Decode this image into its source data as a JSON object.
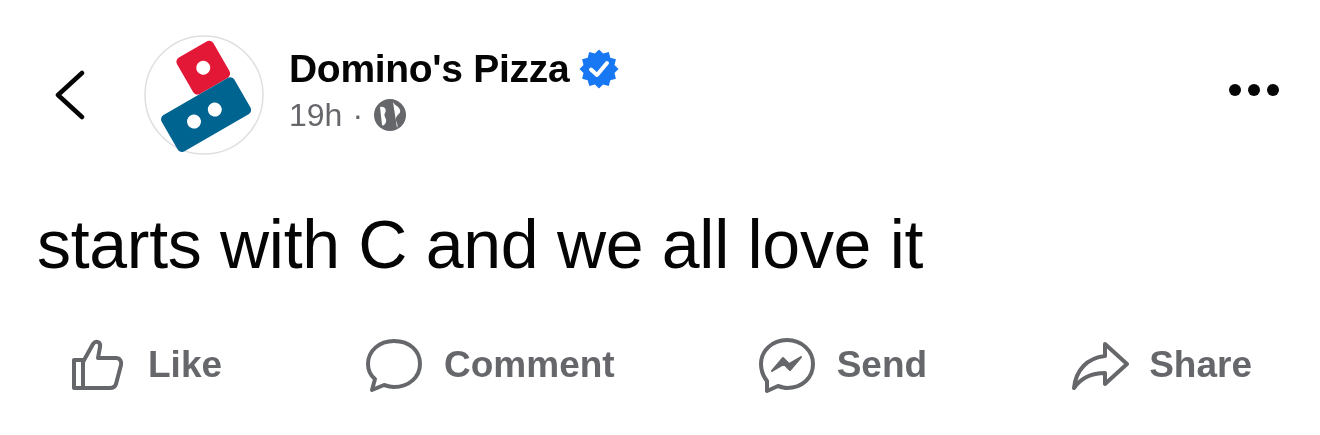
{
  "post": {
    "page_name": "Domino's Pizza",
    "verified": true,
    "time": "19h",
    "separator": "·",
    "text": "starts with C and we all love it"
  },
  "actions": [
    {
      "kind": "like",
      "label": "Like"
    },
    {
      "kind": "comment",
      "label": "Comment"
    },
    {
      "kind": "send",
      "label": "Send"
    },
    {
      "kind": "share",
      "label": "Share"
    }
  ]
}
